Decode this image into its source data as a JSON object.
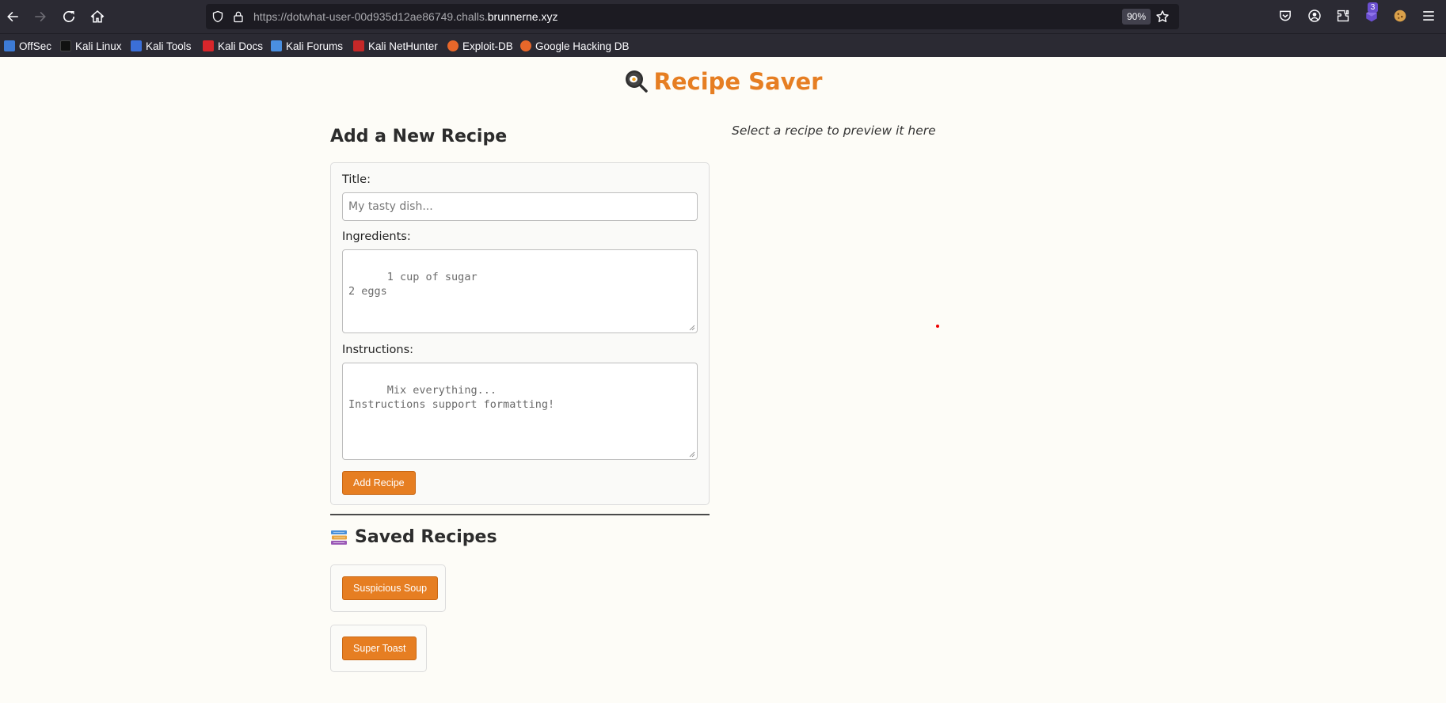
{
  "browser": {
    "url_prefix": "https://dotwhat-user-00d935d12ae86749.challs.",
    "url_domain": "brunnerne.xyz",
    "zoom": "90%",
    "extension_badge": "3",
    "icons": [
      "back-icon",
      "forward-icon",
      "reload-icon",
      "home-icon",
      "shield-icon",
      "lock-icon",
      "star-icon",
      "pocket-icon",
      "account-icon",
      "extensions-icon",
      "menu-icon"
    ]
  },
  "bookmarks": [
    {
      "label": "OffSec",
      "color": "#3d7bd6"
    },
    {
      "label": "Kali Linux",
      "color": "#111111"
    },
    {
      "label": "Kali Tools",
      "color": "#3b6fd8"
    },
    {
      "label": "Kali Docs",
      "color": "#d8262b"
    },
    {
      "label": "Kali Forums",
      "color": "#4a8fe0"
    },
    {
      "label": "Kali NetHunter",
      "color": "#c62828"
    },
    {
      "label": "Exploit-DB",
      "color": "#e8672a"
    },
    {
      "label": "Google Hacking DB",
      "color": "#e8672a"
    }
  ],
  "page": {
    "title": "Recipe Saver",
    "title_color": "#e67e22",
    "accent": "#e67e22"
  },
  "form": {
    "heading": "Add a New Recipe",
    "title_label": "Title:",
    "title_placeholder": "My tasty dish...",
    "ingredients_label": "Ingredients:",
    "ingredients_placeholder": "1 cup of sugar\n2 eggs",
    "instructions_label": "Instructions:",
    "instructions_placeholder": "Mix everything...\nInstructions support formatting!",
    "submit_label": "Add Recipe"
  },
  "saved": {
    "heading": "Saved Recipes",
    "recipes": [
      {
        "label": "Suspicious Soup"
      },
      {
        "label": "Super Toast"
      }
    ]
  },
  "preview": {
    "hint": "Select a recipe to preview it here"
  }
}
